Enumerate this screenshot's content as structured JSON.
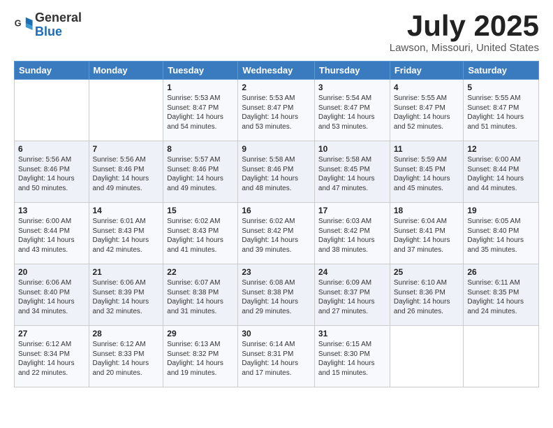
{
  "header": {
    "logo_line1": "General",
    "logo_line2": "Blue",
    "month": "July 2025",
    "location": "Lawson, Missouri, United States"
  },
  "weekdays": [
    "Sunday",
    "Monday",
    "Tuesday",
    "Wednesday",
    "Thursday",
    "Friday",
    "Saturday"
  ],
  "weeks": [
    [
      {
        "num": "",
        "info": ""
      },
      {
        "num": "",
        "info": ""
      },
      {
        "num": "1",
        "info": "Sunrise: 5:53 AM\nSunset: 8:47 PM\nDaylight: 14 hours\nand 54 minutes."
      },
      {
        "num": "2",
        "info": "Sunrise: 5:53 AM\nSunset: 8:47 PM\nDaylight: 14 hours\nand 53 minutes."
      },
      {
        "num": "3",
        "info": "Sunrise: 5:54 AM\nSunset: 8:47 PM\nDaylight: 14 hours\nand 53 minutes."
      },
      {
        "num": "4",
        "info": "Sunrise: 5:55 AM\nSunset: 8:47 PM\nDaylight: 14 hours\nand 52 minutes."
      },
      {
        "num": "5",
        "info": "Sunrise: 5:55 AM\nSunset: 8:47 PM\nDaylight: 14 hours\nand 51 minutes."
      }
    ],
    [
      {
        "num": "6",
        "info": "Sunrise: 5:56 AM\nSunset: 8:46 PM\nDaylight: 14 hours\nand 50 minutes."
      },
      {
        "num": "7",
        "info": "Sunrise: 5:56 AM\nSunset: 8:46 PM\nDaylight: 14 hours\nand 49 minutes."
      },
      {
        "num": "8",
        "info": "Sunrise: 5:57 AM\nSunset: 8:46 PM\nDaylight: 14 hours\nand 49 minutes."
      },
      {
        "num": "9",
        "info": "Sunrise: 5:58 AM\nSunset: 8:46 PM\nDaylight: 14 hours\nand 48 minutes."
      },
      {
        "num": "10",
        "info": "Sunrise: 5:58 AM\nSunset: 8:45 PM\nDaylight: 14 hours\nand 47 minutes."
      },
      {
        "num": "11",
        "info": "Sunrise: 5:59 AM\nSunset: 8:45 PM\nDaylight: 14 hours\nand 45 minutes."
      },
      {
        "num": "12",
        "info": "Sunrise: 6:00 AM\nSunset: 8:44 PM\nDaylight: 14 hours\nand 44 minutes."
      }
    ],
    [
      {
        "num": "13",
        "info": "Sunrise: 6:00 AM\nSunset: 8:44 PM\nDaylight: 14 hours\nand 43 minutes."
      },
      {
        "num": "14",
        "info": "Sunrise: 6:01 AM\nSunset: 8:43 PM\nDaylight: 14 hours\nand 42 minutes."
      },
      {
        "num": "15",
        "info": "Sunrise: 6:02 AM\nSunset: 8:43 PM\nDaylight: 14 hours\nand 41 minutes."
      },
      {
        "num": "16",
        "info": "Sunrise: 6:02 AM\nSunset: 8:42 PM\nDaylight: 14 hours\nand 39 minutes."
      },
      {
        "num": "17",
        "info": "Sunrise: 6:03 AM\nSunset: 8:42 PM\nDaylight: 14 hours\nand 38 minutes."
      },
      {
        "num": "18",
        "info": "Sunrise: 6:04 AM\nSunset: 8:41 PM\nDaylight: 14 hours\nand 37 minutes."
      },
      {
        "num": "19",
        "info": "Sunrise: 6:05 AM\nSunset: 8:40 PM\nDaylight: 14 hours\nand 35 minutes."
      }
    ],
    [
      {
        "num": "20",
        "info": "Sunrise: 6:06 AM\nSunset: 8:40 PM\nDaylight: 14 hours\nand 34 minutes."
      },
      {
        "num": "21",
        "info": "Sunrise: 6:06 AM\nSunset: 8:39 PM\nDaylight: 14 hours\nand 32 minutes."
      },
      {
        "num": "22",
        "info": "Sunrise: 6:07 AM\nSunset: 8:38 PM\nDaylight: 14 hours\nand 31 minutes."
      },
      {
        "num": "23",
        "info": "Sunrise: 6:08 AM\nSunset: 8:38 PM\nDaylight: 14 hours\nand 29 minutes."
      },
      {
        "num": "24",
        "info": "Sunrise: 6:09 AM\nSunset: 8:37 PM\nDaylight: 14 hours\nand 27 minutes."
      },
      {
        "num": "25",
        "info": "Sunrise: 6:10 AM\nSunset: 8:36 PM\nDaylight: 14 hours\nand 26 minutes."
      },
      {
        "num": "26",
        "info": "Sunrise: 6:11 AM\nSunset: 8:35 PM\nDaylight: 14 hours\nand 24 minutes."
      }
    ],
    [
      {
        "num": "27",
        "info": "Sunrise: 6:12 AM\nSunset: 8:34 PM\nDaylight: 14 hours\nand 22 minutes."
      },
      {
        "num": "28",
        "info": "Sunrise: 6:12 AM\nSunset: 8:33 PM\nDaylight: 14 hours\nand 20 minutes."
      },
      {
        "num": "29",
        "info": "Sunrise: 6:13 AM\nSunset: 8:32 PM\nDaylight: 14 hours\nand 19 minutes."
      },
      {
        "num": "30",
        "info": "Sunrise: 6:14 AM\nSunset: 8:31 PM\nDaylight: 14 hours\nand 17 minutes."
      },
      {
        "num": "31",
        "info": "Sunrise: 6:15 AM\nSunset: 8:30 PM\nDaylight: 14 hours\nand 15 minutes."
      },
      {
        "num": "",
        "info": ""
      },
      {
        "num": "",
        "info": ""
      }
    ]
  ]
}
